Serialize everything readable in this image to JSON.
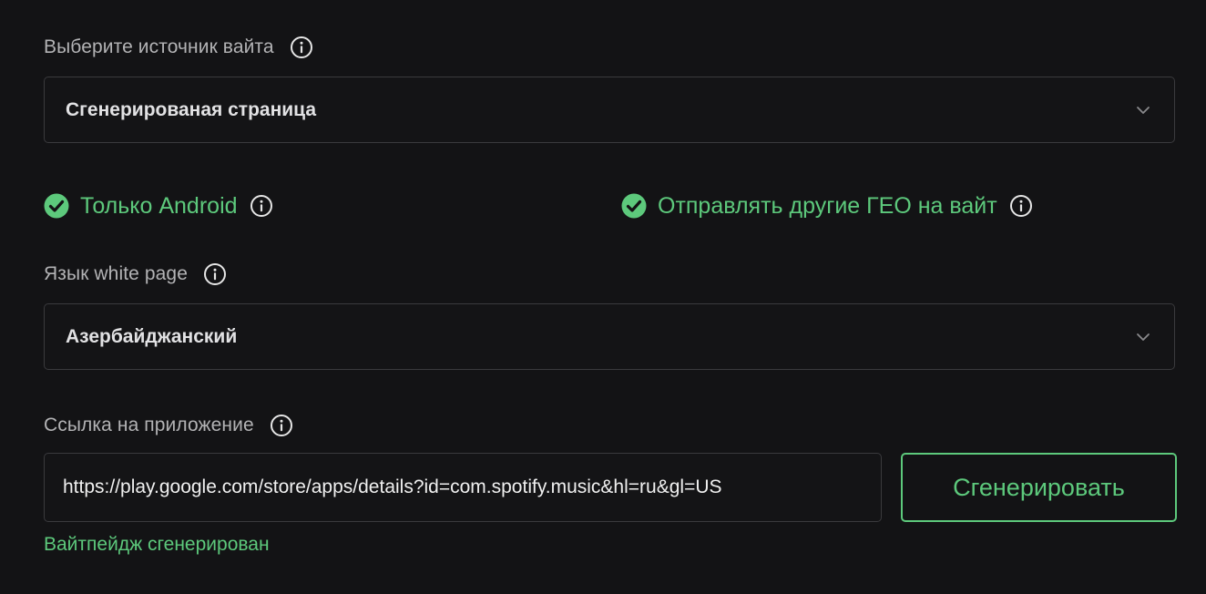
{
  "source": {
    "label": "Выберите источник вайта",
    "selected": "Сгенерированая страница"
  },
  "options": {
    "android_only": "Только Android",
    "send_other_geo": "Отправлять другие ГЕО на вайт"
  },
  "language": {
    "label": "Язык white page",
    "selected": "Азербайджанский"
  },
  "app_link": {
    "label": "Ссылка на приложение",
    "value": "https://play.google.com/store/apps/details?id=com.spotify.music&hl=ru&gl=US",
    "button_label": "Сгенерировать"
  },
  "status": "Вайтпейдж сгенерирован",
  "colors": {
    "background": "#131315",
    "accent_green": "#5dc97c",
    "border": "#3a3a3d",
    "label_gray": "#b3b3b5"
  },
  "icons": {
    "info": "info-circle-icon",
    "check": "check-circle-icon",
    "chevron": "chevron-down-icon"
  }
}
